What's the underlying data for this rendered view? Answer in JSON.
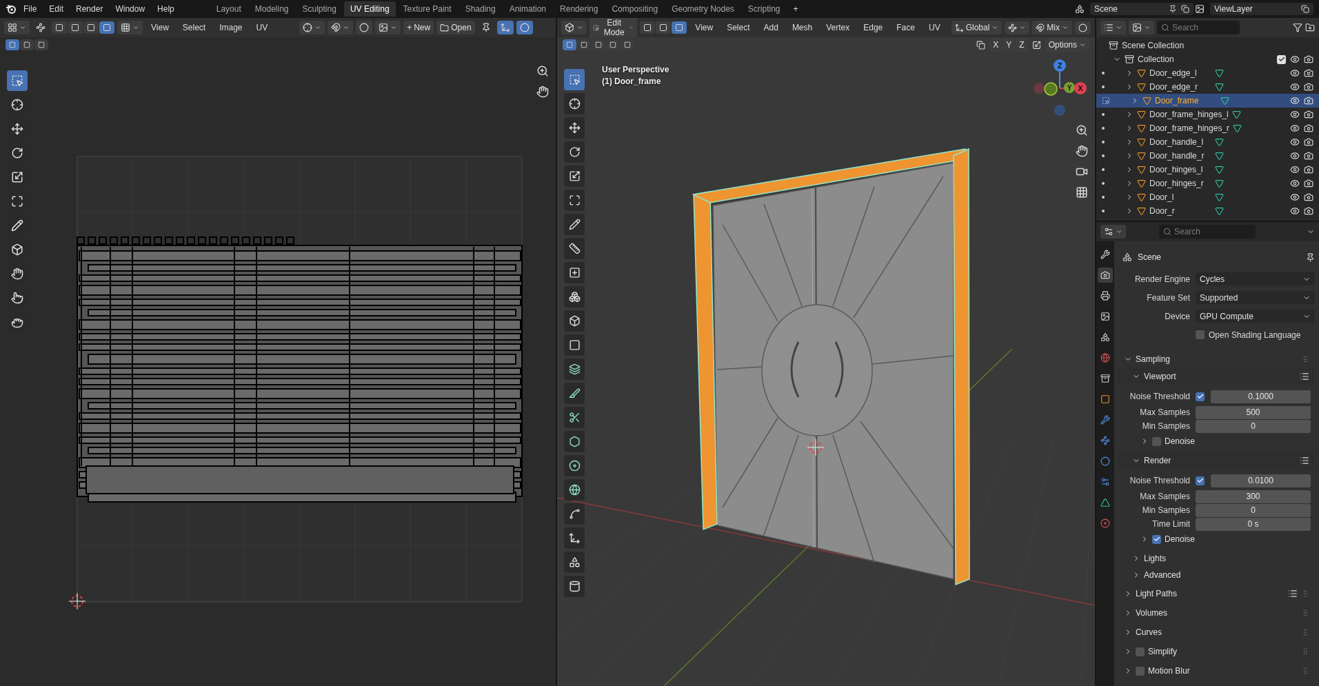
{
  "menu": [
    "File",
    "Edit",
    "Render",
    "Window",
    "Help"
  ],
  "workspaces": [
    {
      "label": "Layout",
      "selected": false
    },
    {
      "label": "Modeling",
      "selected": false
    },
    {
      "label": "Sculpting",
      "selected": false
    },
    {
      "label": "UV Editing",
      "selected": true
    },
    {
      "label": "Texture Paint",
      "selected": false
    },
    {
      "label": "Shading",
      "selected": false
    },
    {
      "label": "Animation",
      "selected": false
    },
    {
      "label": "Rendering",
      "selected": false
    },
    {
      "label": "Compositing",
      "selected": false
    },
    {
      "label": "Geometry Nodes",
      "selected": false
    },
    {
      "label": "Scripting",
      "selected": false
    }
  ],
  "add_workspace": "+",
  "scene": "Scene",
  "view_layer": "ViewLayer",
  "uv_editor": {
    "select_modes": [
      {
        "selected": false
      },
      {
        "selected": false
      },
      {
        "selected": false
      },
      {
        "selected": true
      }
    ],
    "menus": [
      "View",
      "Select",
      "Image",
      "UV"
    ],
    "new_label": "New",
    "new_icon": "+",
    "open_label": "Open",
    "box_modes": [
      {
        "selected": true
      },
      {
        "selected": false
      },
      {
        "selected": false
      }
    ],
    "tools": [
      {
        "selected": true
      },
      {
        "selected": false
      },
      {
        "selected": false
      },
      {
        "selected": false
      },
      {
        "selected": false
      },
      {
        "selected": false
      },
      {
        "selected": false
      },
      {
        "selected": false
      },
      {
        "selected": false
      },
      {
        "selected": false
      },
      {
        "selected": false
      }
    ]
  },
  "viewport": {
    "mode": "Edit Mode",
    "select_modes": [
      {
        "selected": false
      },
      {
        "selected": false
      },
      {
        "selected": true
      }
    ],
    "menus": [
      "View",
      "Select",
      "Add",
      "Mesh",
      "Vertex",
      "Edge",
      "Face",
      "UV"
    ],
    "orientation": "Global",
    "snap_target": "Mix",
    "box_modes": [
      {
        "selected": true
      },
      {
        "selected": false
      },
      {
        "selected": false
      },
      {
        "selected": false
      },
      {
        "selected": false
      }
    ],
    "mirror_axes": [
      "X",
      "Y",
      "Z"
    ],
    "options": "Options",
    "perspective": "User Perspective",
    "object_label": "(1) Door_frame",
    "gizmo_axes": [
      "X",
      "Y",
      "Z"
    ],
    "tools": [
      {
        "selected": true
      },
      {
        "selected": false
      },
      {
        "selected": false
      },
      {
        "selected": false
      },
      {
        "selected": false
      },
      {
        "selected": false
      },
      {
        "selected": false
      },
      {
        "selected": false
      },
      {
        "selected": false
      },
      {
        "selected": false
      },
      {
        "selected": false
      },
      {
        "selected": false
      },
      {
        "selected": false
      },
      {
        "selected": false
      },
      {
        "selected": false
      },
      {
        "selected": false
      },
      {
        "selected": false
      },
      {
        "selected": false
      },
      {
        "selected": false
      },
      {
        "selected": false
      },
      {
        "selected": false
      },
      {
        "selected": false
      }
    ]
  },
  "outliner": {
    "search": {
      "placeholder": "Search"
    },
    "scene_collection": "Scene Collection",
    "collection": {
      "name": "Collection",
      "checked": true
    },
    "objects": [
      {
        "name": "Door_edge_l",
        "selected": false
      },
      {
        "name": "Door_edge_r",
        "selected": false
      },
      {
        "name": "Door_frame",
        "selected": true
      },
      {
        "name": "Door_frame_hinges_l",
        "selected": false
      },
      {
        "name": "Door_frame_hinges_r",
        "selected": false
      },
      {
        "name": "Door_handle_l",
        "selected": false
      },
      {
        "name": "Door_handle_r",
        "selected": false
      },
      {
        "name": "Door_hinges_l",
        "selected": false
      },
      {
        "name": "Door_hinges_r",
        "selected": false
      },
      {
        "name": "Door_l",
        "selected": false
      },
      {
        "name": "Door_r",
        "selected": false
      }
    ]
  },
  "properties": {
    "search": {
      "placeholder": "Search"
    },
    "context": "Scene",
    "tabs": [
      {
        "selected": false
      },
      {
        "selected": true
      },
      {
        "selected": false
      },
      {
        "selected": false
      },
      {
        "selected": false
      },
      {
        "selected": false
      },
      {
        "selected": false
      },
      {
        "selected": false
      },
      {
        "selected": false
      },
      {
        "selected": false
      },
      {
        "selected": false
      },
      {
        "selected": false
      },
      {
        "selected": false
      },
      {
        "selected": false
      }
    ],
    "fields": [
      {
        "kind": "dropdown",
        "label": "Render Engine",
        "value": "Cycles"
      },
      {
        "kind": "dropdown",
        "label": "Feature Set",
        "value": "Supported"
      },
      {
        "kind": "dropdown",
        "label": "Device",
        "value": "GPU Compute"
      },
      {
        "kind": "checkbox",
        "label": "Open Shading Language",
        "checked": false
      }
    ],
    "panels": [
      {
        "title": "Sampling",
        "expanded": true,
        "children": [
          {
            "title": "Viewport",
            "expanded": true,
            "presets": true,
            "fields": [
              {
                "kind": "checked_number",
                "label": "Noise Threshold",
                "checked": true,
                "value": "0.1000"
              },
              {
                "kind": "number",
                "label": "Max Samples",
                "value": "500"
              },
              {
                "kind": "number",
                "label": "Min Samples",
                "value": "0"
              }
            ],
            "children": [
              {
                "title": "Denoise",
                "expanded": false,
                "checked": false
              }
            ]
          },
          {
            "title": "Render",
            "expanded": true,
            "presets": true,
            "fields": [
              {
                "kind": "checked_number",
                "label": "Noise Threshold",
                "checked": true,
                "value": "0.0100"
              },
              {
                "kind": "number",
                "label": "Max Samples",
                "value": "300"
              },
              {
                "kind": "number",
                "label": "Min Samples",
                "value": "0"
              },
              {
                "kind": "number",
                "label": "Time Limit",
                "value": "0 s"
              }
            ],
            "children": [
              {
                "title": "Denoise",
                "expanded": false,
                "checked": true
              }
            ]
          },
          {
            "title": "Lights",
            "expanded": false
          },
          {
            "title": "Advanced",
            "expanded": false
          }
        ]
      },
      {
        "title": "Light Paths",
        "expanded": false,
        "presets": true
      },
      {
        "title": "Volumes",
        "expanded": false
      },
      {
        "title": "Curves",
        "expanded": false
      },
      {
        "title": "Simplify",
        "expanded": false,
        "checked": false
      },
      {
        "title": "Motion Blur",
        "expanded": false,
        "checked": false
      }
    ]
  }
}
